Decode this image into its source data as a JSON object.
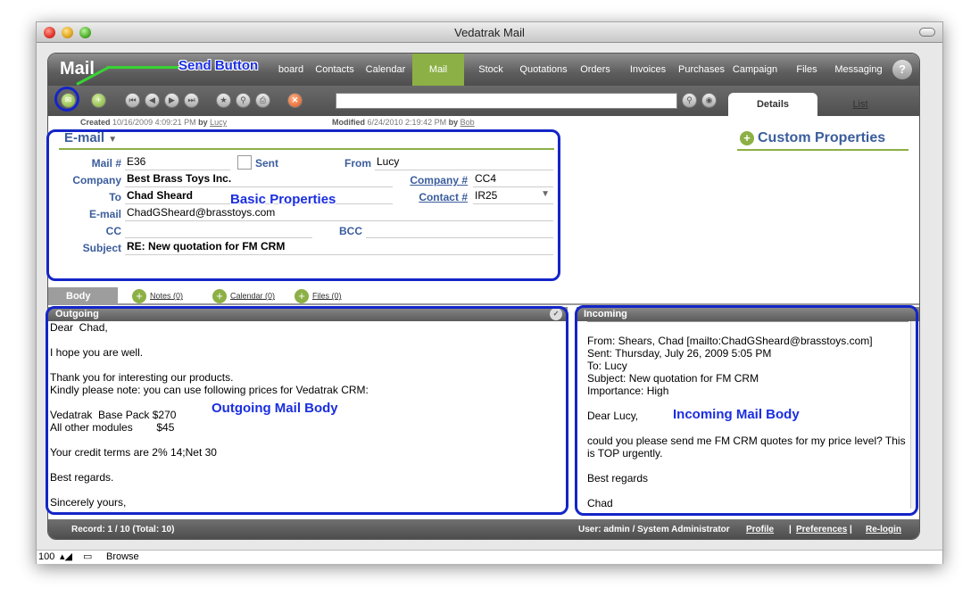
{
  "window": {
    "title": "Vedatrak Mail"
  },
  "app": {
    "brand": "Mail"
  },
  "nav": [
    {
      "label": "board"
    },
    {
      "label": "Contacts"
    },
    {
      "label": "Calendar"
    },
    {
      "label": "Mail"
    },
    {
      "label": "Stock"
    },
    {
      "label": "Quotations"
    },
    {
      "label": "Orders"
    },
    {
      "label": "Invoices"
    },
    {
      "label": "Purchases"
    },
    {
      "label": "Campaign"
    },
    {
      "label": "Files"
    },
    {
      "label": "Messaging"
    }
  ],
  "help": "?",
  "search": {
    "value": ""
  },
  "tabs": {
    "details": "Details",
    "list": "List"
  },
  "meta": {
    "created_label": "Created",
    "created": "10/16/2009 4:09:21 PM",
    "by1": "by",
    "created_by": "Lucy",
    "modified_label": "Modified",
    "modified": "6/24/2010 2:19:42 PM",
    "by2": "by",
    "modified_by": "Bob"
  },
  "section": {
    "title": "E-mail",
    "custom_properties": "Custom Properties"
  },
  "fields": {
    "mail_no_label": "Mail #",
    "mail_no": "E36",
    "sent_label": "Sent",
    "from_label": "From",
    "from": "Lucy",
    "company_label": "Company",
    "company": "Best Brass Toys Inc.",
    "company_no_label": "Company #",
    "company_no": "CC4",
    "to_label": "To",
    "to": "Chad Sheard",
    "contact_no_label": "Contact #",
    "contact_no": "IR25",
    "email_label": "E-mail",
    "email": "ChadGSheard@brasstoys.com",
    "cc_label": "CC",
    "cc": "",
    "bcc_label": "BCC",
    "bcc": "",
    "subject_label": "Subject",
    "subject": "RE: New quotation for FM CRM"
  },
  "subtabs": {
    "body": "Body",
    "notes": "Notes (0)",
    "calendar": "Calendar (0)",
    "files": "Files (0)"
  },
  "outgoing": {
    "header": "Outgoing",
    "body": "Dear  Chad,\n\nI hope you are well.\n\nThank you for interesting our products.\nKindly please note: you can use following prices for Vedatrak CRM:\n\nVedatrak  Base Pack $270\nAll other modules        $45\n\nYour credit terms are 2% 14;Net 30\n\nBest regards.\n\nSincerely yours,"
  },
  "incoming": {
    "header": "Incoming",
    "body": "From: Shears, Chad [mailto:ChadGSheard@brasstoys.com]\nSent: Thursday, July 26, 2009 5:05 PM\nTo: Lucy\nSubject: New quotation for FM CRM\nImportance: High\n\nDear Lucy,\n\ncould you please send me FM CRM quotes for my price level? This is TOP urgently.\n\nBest regards\n\nChad"
  },
  "status": {
    "record": "Record: 1 / 10 (Total: 10)",
    "user": "User: admin / System Administrator",
    "profile": "Profile",
    "preferences": "Preferences",
    "relogin": "Re-login"
  },
  "bottom": {
    "zoom": "100",
    "mode": "Browse"
  },
  "annotations": {
    "send_button": "Send Button",
    "basic_properties": "Basic Properties",
    "outgoing_body": "Outgoing Mail Body",
    "incoming_body": "Incoming Mail Body"
  },
  "colors": {
    "accent_green": "#8cb045",
    "label_blue": "#3a5d9c",
    "annotation_blue": "#1425c8"
  }
}
